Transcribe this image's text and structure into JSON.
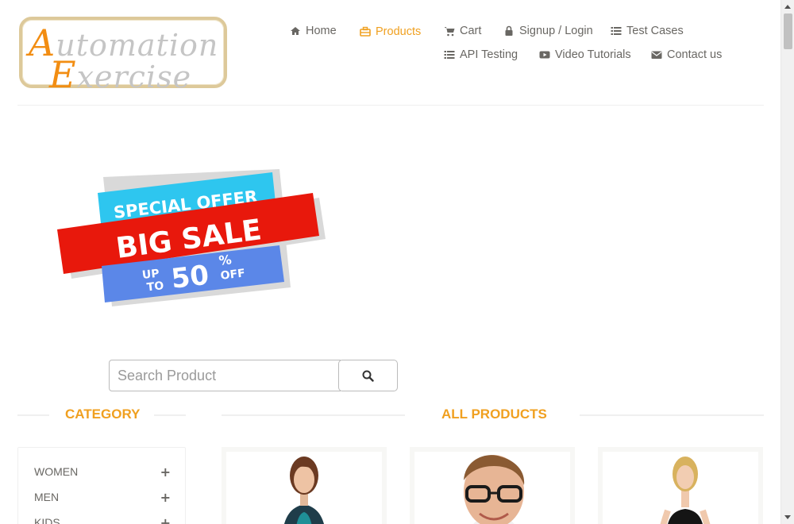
{
  "logo": {
    "line1": "utomation",
    "line1_cap": "A",
    "line2": "xercise",
    "line2_cap": "E"
  },
  "nav": {
    "items": [
      {
        "label": "Home",
        "icon": "home-icon"
      },
      {
        "label": "Products",
        "icon": "products-icon",
        "active": true
      },
      {
        "label": "Cart",
        "icon": "cart-icon"
      },
      {
        "label": "Signup / Login",
        "icon": "lock-icon"
      },
      {
        "label": "Test Cases",
        "icon": "list-icon"
      },
      {
        "label": "API Testing",
        "icon": "list-icon"
      },
      {
        "label": "Video Tutorials",
        "icon": "youtube-icon"
      },
      {
        "label": "Contact us",
        "icon": "envelope-icon"
      }
    ]
  },
  "banner": {
    "line1": "SPECIAL OFFER",
    "line2": "BIG SALE",
    "line3_up": "UP",
    "line3_to": "TO",
    "line3_value": "50",
    "line3_pct": "%",
    "line3_off": "OFF"
  },
  "search": {
    "placeholder": "Search Product",
    "value": ""
  },
  "category": {
    "heading": "Category",
    "items": [
      {
        "label": "Women"
      },
      {
        "label": "Men"
      },
      {
        "label": "Kids"
      }
    ]
  },
  "products": {
    "heading": "All Products"
  },
  "colors": {
    "accent": "#f0a020",
    "text": "#696763",
    "banner_red": "#e8180c",
    "banner_cyan": "#2ec6ef",
    "banner_blue": "#5b87e8"
  }
}
